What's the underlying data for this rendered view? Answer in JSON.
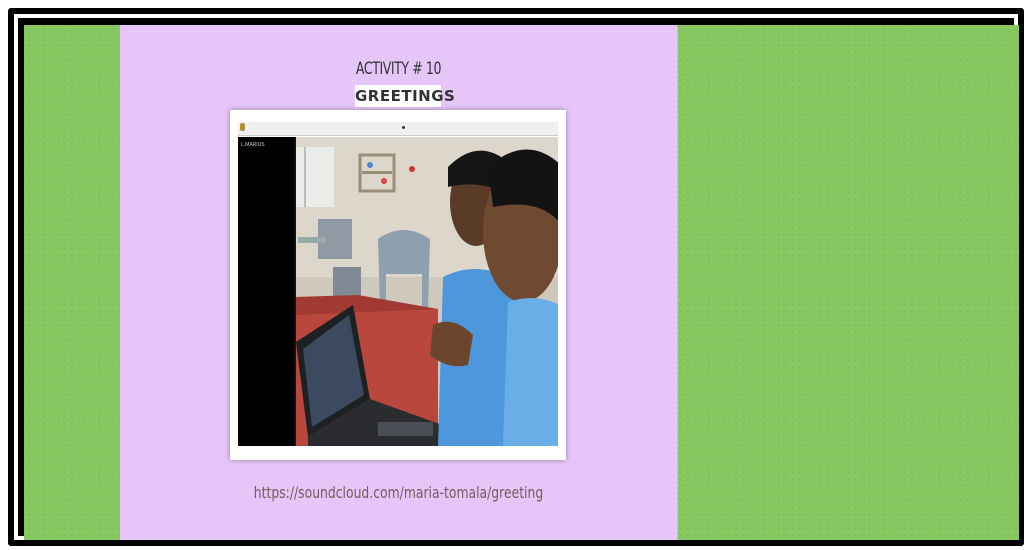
{
  "activity": {
    "title": "ACTIVITY # 10",
    "subtitle": "GREETINGS",
    "link_url": "https://soundcloud.com/maria-tomala/greeting"
  },
  "video": {
    "camera_label": "L.MARIUS"
  },
  "colors": {
    "background_green": "#86c75f",
    "panel_lilac": "#e6c6f8",
    "frame_black": "#000000",
    "link_text": "#7a5a5a"
  }
}
